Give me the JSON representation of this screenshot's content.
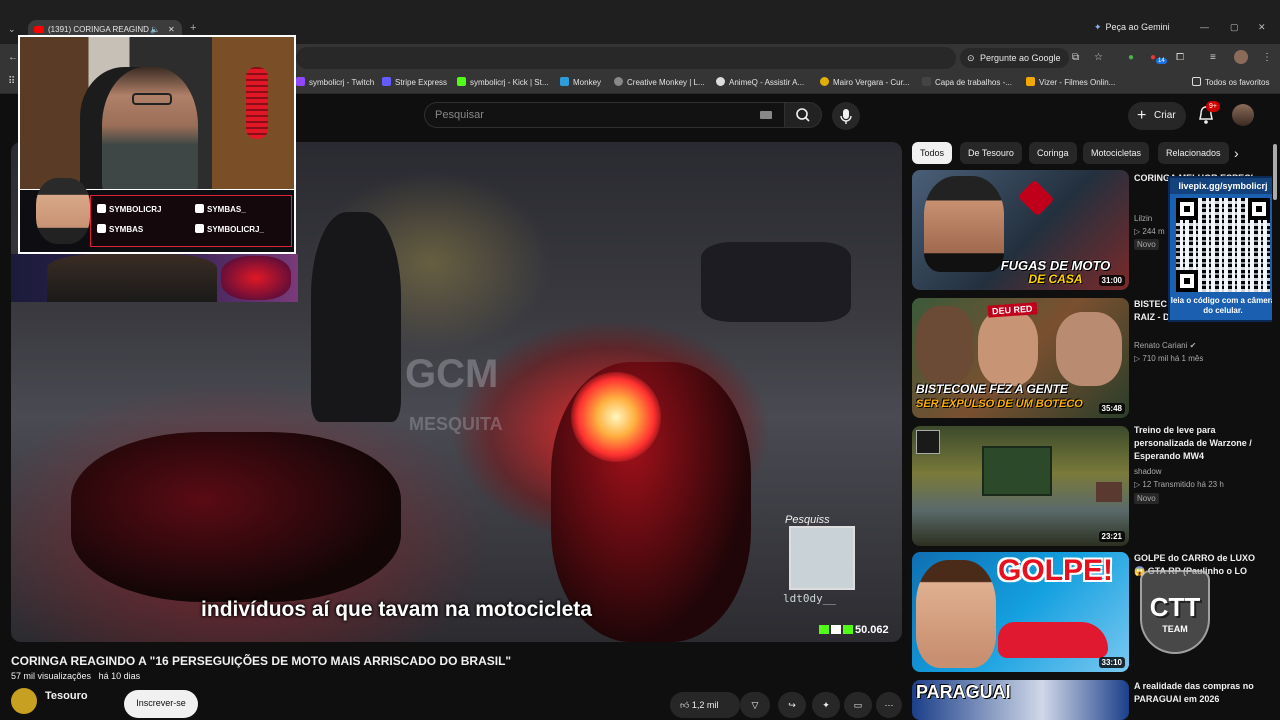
{
  "browser": {
    "tab_title": "(1391) CORINGA REAGIND",
    "gemini_label": "Peça ao Gemini",
    "google_chip": "Pergunte ao Google",
    "extension_badge": "14",
    "bookmarks": [
      {
        "label": "symbolicrj - Twitch",
        "color": "#9146ff"
      },
      {
        "label": "Stripe Express",
        "color": "#635bff"
      },
      {
        "label": "symbolicrj - Kick | St...",
        "color": "#53fc18"
      },
      {
        "label": "Monkey",
        "color": "#2d9cdb"
      },
      {
        "label": "Creative Monkey | L...",
        "color": "#888888"
      },
      {
        "label": "AnimeQ - Assistir A...",
        "color": "#dddddd"
      },
      {
        "label": "Mairo Vergara - Cur...",
        "color": "#e0b000"
      },
      {
        "label": "Capa de trabalhos -...",
        "color": "#444444"
      },
      {
        "label": "Vizer - Filmes Onlin...",
        "color": "#f2a900"
      }
    ],
    "all_bookmarks": "Todos os favoritos"
  },
  "youtube": {
    "search_placeholder": "Pesquisar",
    "create_label": "Criar",
    "notifications": "9+"
  },
  "video": {
    "watermark": "GCM",
    "watermark_sub": "MESQUITA",
    "subtitle": "indivíduos aí que tavam na motocicleta",
    "small_cam_name": "ldt0dy__",
    "small_cam_sig": "Pesquiss",
    "viewer_count": "50.062",
    "title": "CORINGA REAGINDO A \"16 PERSEGUIÇÕES DE MOTO MAIS ARRISCADO DO BRASIL\"",
    "views": "57 mil visualizações",
    "age": "há 10 dias",
    "channel": "Tesouro",
    "subscribe": "Inscrever-se",
    "likes": "1,2 mil"
  },
  "overlay": {
    "socials": [
      {
        "label": "SYMBOLICRJ",
        "icon": "twitch-icon"
      },
      {
        "label": "SYMBAS_",
        "icon": "instagram-icon"
      },
      {
        "label": "SYMBAS",
        "icon": "youtube-icon"
      },
      {
        "label": "SYMBOLICRJ_",
        "icon": "instagram-icon"
      }
    ],
    "qr_url": "livepix.gg/symbolicrj",
    "qr_caption": "leia o código com a câmera do celular.",
    "ctt_main": "CTT",
    "ctt_sub": "TEAM"
  },
  "chips": [
    "Todos",
    "De Tesouro",
    "Coringa",
    "Motocicletas",
    "Relacionados"
  ],
  "recommendations": [
    {
      "title": "CORINGA MELHOR ESPECI",
      "channel": "Lilzin",
      "views": "244 m",
      "age": "",
      "duration": "31:00",
      "badge": "Novo",
      "thumb_text": "FUGAS DE MOTO",
      "thumb_text2": "DE CASA"
    },
    {
      "title": "BISTEC SER EX BOTECO RAIZ - DEU RUIM !!!",
      "channel": "Renato Cariani",
      "views": "710 mil",
      "age": "há 1 mês",
      "duration": "35:48",
      "badge": "",
      "thumb_text": "BISTECONE FEZ A GENTE",
      "thumb_text2": "SER EXPULSO DE UM BOTECO",
      "thumb_tag": "DEU RED"
    },
    {
      "title": "Treino de leve para personalizada de Warzone / Esperando MW4",
      "channel": "shadow",
      "views": "12",
      "age": "Transmitido há 23 h",
      "duration": "23:21",
      "badge": "Novo"
    },
    {
      "title": "GOLPE do CARRO de LUXO 😱 GTA RP (Paulinho o LO",
      "channel": "",
      "views": "",
      "age": "",
      "duration": "33:10",
      "badge": "",
      "thumb_text": "GOLPE!"
    },
    {
      "title": "A realidade das compras no PARAGUAI em 2026",
      "channel": "",
      "views": "",
      "age": "",
      "duration": "",
      "badge": "",
      "thumb_text": "PARAGUAI"
    }
  ]
}
